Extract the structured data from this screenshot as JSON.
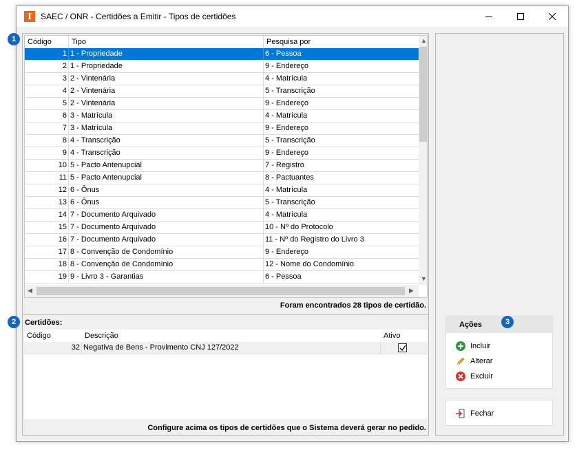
{
  "window": {
    "title": "SAEC / ONR - Certidões a Emitir - Tipos de certidões",
    "app_icon_glyph": "I",
    "controls": {
      "minimize": "minimize-icon",
      "maximize": "maximize-icon",
      "close": "close-icon"
    }
  },
  "badges": [
    "1",
    "2",
    "3"
  ],
  "tipos_grid": {
    "columns": [
      "Código",
      "Tipo",
      "Pesquisa por"
    ],
    "rows": [
      [
        "1",
        "1 - Propriedade",
        "6 - Pessoa"
      ],
      [
        "2",
        "1 - Propriedade",
        "9 - Endereço"
      ],
      [
        "3",
        "2 - Vintenária",
        "4 - Matrícula"
      ],
      [
        "4",
        "2 - Vintenária",
        "5 - Transcrição"
      ],
      [
        "5",
        "2 - Vintenária",
        "9 - Endereço"
      ],
      [
        "6",
        "3 - Matrícula",
        "4 - Matrícula"
      ],
      [
        "7",
        "3 - Matrícula",
        "9 - Endereço"
      ],
      [
        "8",
        "4 - Transcrição",
        "5 - Transcrição"
      ],
      [
        "9",
        "4 - Transcrição",
        "9 - Endereço"
      ],
      [
        "10",
        "5 - Pacto Antenupcial",
        "7 - Registro"
      ],
      [
        "11",
        "5 - Pacto Antenupcial",
        "8 - Pactuantes"
      ],
      [
        "12",
        "6 - Ônus",
        "4 - Matrícula"
      ],
      [
        "13",
        "6 - Ônus",
        "5 - Transcrição"
      ],
      [
        "14",
        "7 - Documento Arquivado",
        "4 - Matrícula"
      ],
      [
        "15",
        "7 - Documento Arquivado",
        "10 - Nº do Protocolo"
      ],
      [
        "16",
        "7 - Documento Arquivado",
        "11 - Nº do Registro do Livro 3"
      ],
      [
        "17",
        "8 - Convenção de Condomínio",
        "9 - Endereço"
      ],
      [
        "18",
        "8 - Convenção de Condomínio",
        "12 - Nome do Condomínio"
      ],
      [
        "19",
        "9 - Livro 3 - Garantias",
        "6 - Pessoa"
      ]
    ],
    "selected_index": 0,
    "footer": "Foram encontrados 28 tipos de certidão."
  },
  "certidoes": {
    "label": "Certidões:",
    "columns": [
      "Código",
      "Descrição",
      "Ativo"
    ],
    "rows": [
      {
        "codigo": "32",
        "descricao": "Negativa de Bens - Provimento CNJ 127/2022",
        "ativo": true
      }
    ],
    "footer": "Configure acima os tipos de certidões que o Sistema deverá gerar no pedido."
  },
  "acoes": {
    "title": "Ações",
    "items": [
      {
        "label": "Incluir",
        "icon": "plus-circle-icon",
        "color": "#2e9a3c"
      },
      {
        "label": "Alterar",
        "icon": "pencil-icon",
        "color": "#f0a020"
      },
      {
        "label": "Excluir",
        "icon": "x-circle-icon",
        "color": "#d93030"
      }
    ]
  },
  "fechar": {
    "label": "Fechar",
    "icon": "exit-icon"
  },
  "colors": {
    "selection": "#0078d7",
    "badge": "#1565c0",
    "app_icon": "#e8691d"
  }
}
